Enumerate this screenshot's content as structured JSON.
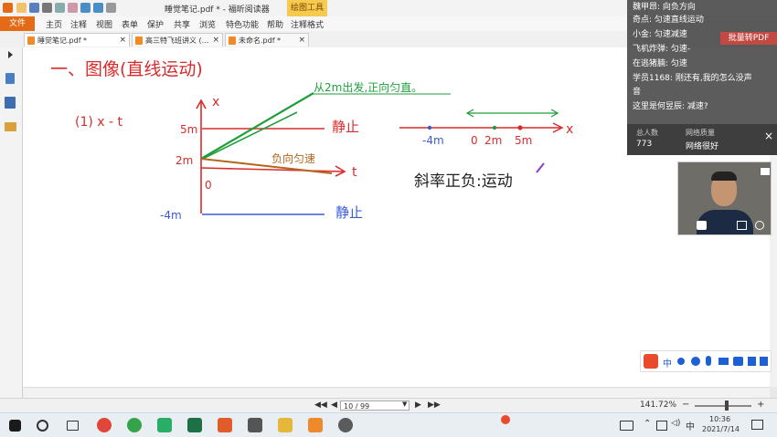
{
  "app": {
    "title": "睡觉笔记.pdf * - 福昕阅读器",
    "context_tab": "绘图工具",
    "file_tab": "文件",
    "menu": [
      "主页",
      "注释",
      "视图",
      "表单",
      "保护",
      "共享",
      "浏览",
      "特色功能",
      "帮助",
      "注释格式"
    ]
  },
  "tabs": [
    {
      "label": "睡觉笔记.pdf *",
      "close": "×",
      "active": true
    },
    {
      "label": "高三特飞班讲义 (...",
      "close": "×",
      "active": false
    },
    {
      "label": "未命名.pdf *",
      "close": "×",
      "active": false
    }
  ],
  "notes": {
    "heading": "一、图像(直线运动)",
    "subheading": "(1) x - t",
    "axis_x": "x",
    "axis_t": "t",
    "label_5m": "5m",
    "label_2m": "2m",
    "label_0": "0",
    "label_neg4m": "-4m",
    "stationary_top": "静止",
    "stationary_bottom": "静止",
    "green_note": "从2m出发,正向匀直。",
    "brown_note": "负向匀速",
    "number_line_axis": "x",
    "number_line_labels": [
      "-4m",
      "0",
      "2m",
      "5m"
    ],
    "slope_note": "斜率正负:运动"
  },
  "chat": {
    "messages": [
      {
        "name": "魏甲昂:",
        "text": "向负方向"
      },
      {
        "name": "奇点:",
        "text": "匀速直线运动"
      },
      {
        "name": "小金:",
        "text": "匀速减速"
      },
      {
        "name": "飞机炸弹:",
        "text": "匀速-"
      },
      {
        "name": "在逃猪腩:",
        "text": "匀速"
      },
      {
        "name": "学员1168:",
        "text": "刚还有,我的怎么没声"
      },
      {
        "name": "",
        "text": "音"
      },
      {
        "name": "这里是何昱辰:",
        "text": "减速?"
      }
    ],
    "watermark": "批量转PDF",
    "total_label": "总人数",
    "total_value": "773",
    "network_label": "网络质量",
    "network_value": "网络很好",
    "close": "×"
  },
  "status": {
    "page": "10 / 99",
    "zoom": "141.72%",
    "zoom_minus": "−",
    "zoom_plus": "+"
  },
  "ime": {
    "mode": "中"
  },
  "taskbar": {
    "time": "10:36",
    "date": "2021/7/14",
    "ime_lang": "中"
  }
}
